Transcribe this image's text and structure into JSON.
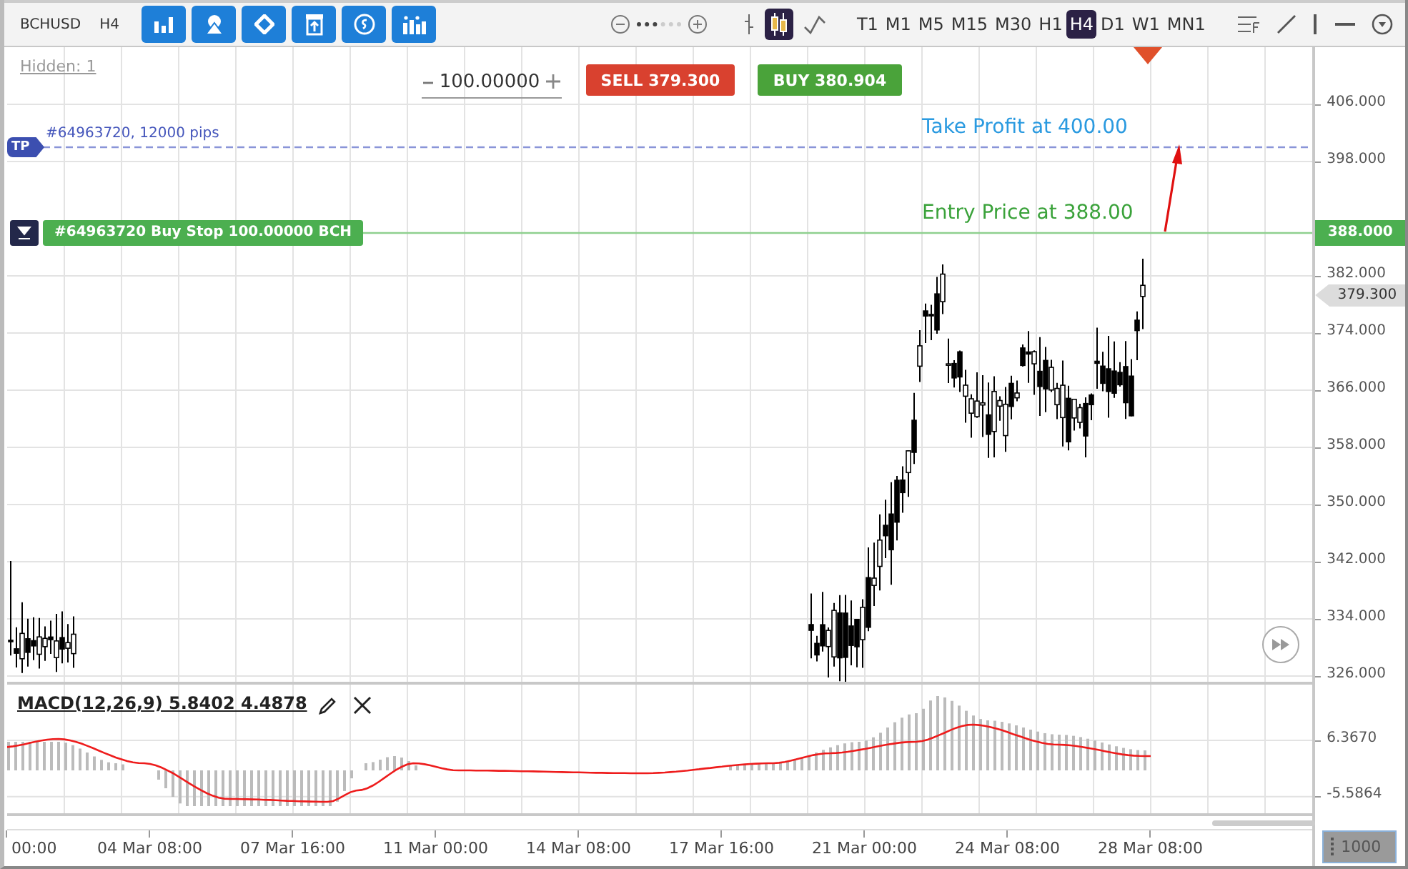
{
  "toolbar": {
    "symbol": "BCHUSD",
    "timeframe": "H4",
    "chart_types": [
      {
        "kind": "bars",
        "selected": false
      },
      {
        "kind": "candles",
        "selected": true
      },
      {
        "kind": "line",
        "selected": false
      }
    ],
    "periods": [
      {
        "label": "T1",
        "selected": false
      },
      {
        "label": "M1",
        "selected": false
      },
      {
        "label": "M5",
        "selected": false
      },
      {
        "label": "M15",
        "selected": false
      },
      {
        "label": "M30",
        "selected": false
      },
      {
        "label": "H1",
        "selected": false
      },
      {
        "label": "H4",
        "selected": true
      },
      {
        "label": "D1",
        "selected": false
      },
      {
        "label": "W1",
        "selected": false
      },
      {
        "label": "MN1",
        "selected": false
      }
    ]
  },
  "chart": {
    "hidden": "Hidden: 1",
    "volume": "100.00000",
    "sell": {
      "label": "SELL",
      "price": "379.**30**0"
    },
    "buy": {
      "label": "BUY",
      "price": "380.**90**4"
    },
    "take_profit": {
      "badge": "TP",
      "label": "#64963720, 12000 pips"
    },
    "entry": {
      "label": "#64963720 Buy Stop 100.00000 BCH",
      "price": "388.000"
    },
    "current_price": "379.300",
    "annotations": [
      {
        "text": "Take Profit at 400.00",
        "color": "#2a9ae0"
      },
      {
        "text": "Entry Price at 388.00",
        "color": "#3aa23a"
      }
    ],
    "price_ticks": [
      "406.000",
      "398.000",
      "382.000",
      "374.000",
      "366.000",
      "358.000",
      "350.000",
      "342.000",
      "334.000",
      "326.000"
    ]
  },
  "macd": {
    "label": "MACD(12,26,9) 5.8402 4.4878",
    "ticks": [
      "6.3670",
      "-5.5864"
    ]
  },
  "time_axis": [
    "00:00",
    "04 Mar 08:00",
    "07 Mar 16:00",
    "11 Mar 00:00",
    "14 Mar 08:00",
    "17 Mar 16:00",
    "21 Mar 00:00",
    "24 Mar 08:00",
    "28 Mar 08:00"
  ],
  "scale_button": "1000"
}
